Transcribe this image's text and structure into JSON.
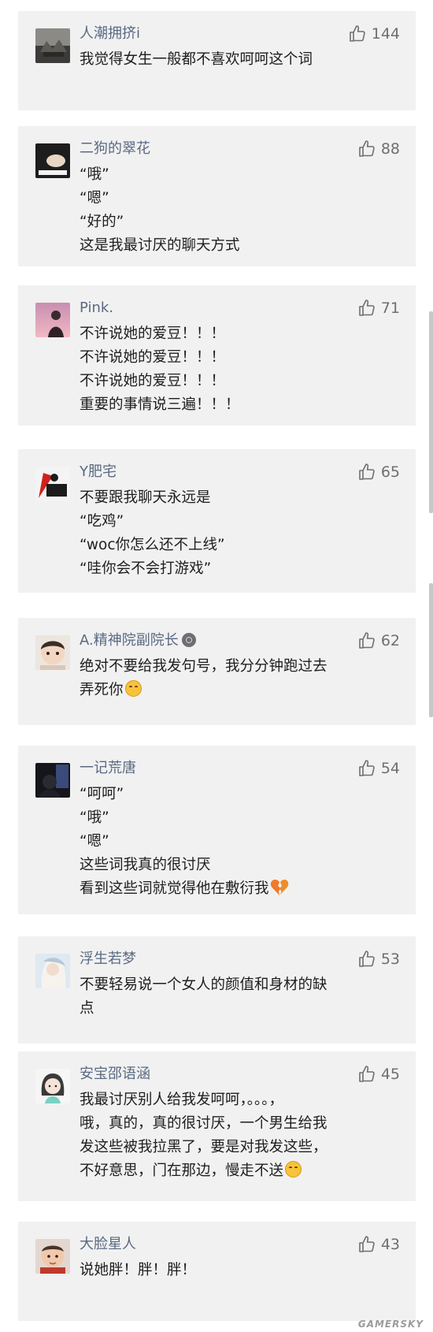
{
  "comments": [
    {
      "username": "人潮拥挤i",
      "likes": "144",
      "lines": [
        "我觉得女生一般都不喜欢呵呵这个词"
      ],
      "avatar_icon": "avatar-landscape-icon"
    },
    {
      "username": "二狗的翠花",
      "likes": "88",
      "lines": [
        "“哦”",
        "“嗯”",
        "“好的”",
        "这是我最讨厌的聊天方式"
      ],
      "avatar_icon": "avatar-hand-icon"
    },
    {
      "username": "Pink.",
      "likes": "71",
      "lines": [
        "不许说她的爱豆！！！",
        "不许说她的爱豆！！！",
        "不许说她的爱豆！！！",
        "重要的事情说三遍！！！"
      ],
      "avatar_icon": "avatar-sunset-person-icon"
    },
    {
      "username": "Y肥宅",
      "likes": "65",
      "lines": [
        "不要跟我聊天永远是",
        "“吃鸡”",
        "“woc你怎么还不上线”",
        "“哇你会不会打游戏”"
      ],
      "avatar_icon": "avatar-red-flag-icon"
    },
    {
      "username": "A.精神院副院长",
      "likes": "62",
      "lines": [
        "绝对不要给我发句号，我分分钟跑过去",
        "弄死你"
      ],
      "avatar_icon": "avatar-baby-icon",
      "name_badge": "badge-icon",
      "end_emoji": "upside-down-face-emoji"
    },
    {
      "username": "一记荒唐",
      "likes": "54",
      "lines": [
        "“呵呵”",
        "“哦”",
        "“嗯”",
        "这些词我真的很讨厌",
        "看到这些词就觉得他在敷衍我"
      ],
      "avatar_icon": "avatar-dark-portrait-icon",
      "end_emoji": "broken-heart-emoji"
    },
    {
      "username": "浮生若梦",
      "likes": "53",
      "lines": [
        "不要轻易说一个女人的颜值和身材的缺",
        "点"
      ],
      "avatar_icon": "avatar-illustration-girl-icon"
    },
    {
      "username": "安宝邵语涵",
      "likes": "45",
      "lines": [
        "我最讨厌别人给我发呵呵，。。。，",
        "哦，真的，真的很讨厌，一个男生给我",
        "发这些被我拉黑了，要是对我发这些，",
        "不好意思，门在那边，慢走不送"
      ],
      "avatar_icon": "avatar-cartoon-girl-icon",
      "end_emoji": "smiling-face-emoji"
    },
    {
      "username": "大脸星人",
      "likes": "43",
      "lines": [
        "说她胖！胖！胖！"
      ],
      "avatar_icon": "avatar-child-photo-icon"
    }
  ],
  "watermark": "GAMERSKY",
  "colors": {
    "card_bg": "#f1f1f1",
    "username": "#5a6a82",
    "text": "#1e1e1e",
    "like": "#6f6f6f"
  }
}
